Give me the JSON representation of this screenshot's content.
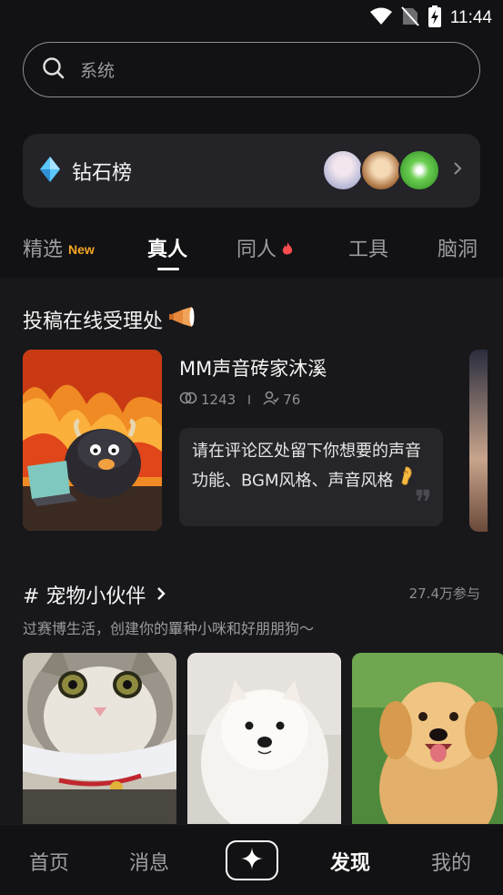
{
  "status_bar": {
    "time": "11:44",
    "icons": [
      "wifi-icon",
      "no-sim-icon",
      "battery-charging-icon"
    ]
  },
  "search": {
    "placeholder": "系统",
    "icon": "search-icon"
  },
  "diamond": {
    "title": "钻石榜",
    "icon": "diamond-icon"
  },
  "tabs": [
    {
      "label": "精选",
      "badge": "New"
    },
    {
      "label": "真人",
      "active": true
    },
    {
      "label": "同人",
      "badge_icon": "fire-icon"
    },
    {
      "label": "工具"
    },
    {
      "label": "脑洞"
    }
  ],
  "section1": {
    "title": "投稿在线受理处",
    "title_icon": "megaphone-icon",
    "card": {
      "name": "MM声音砖家沐溪",
      "views": "1243",
      "followers": "76",
      "quote": "请在评论区处留下你想要的声音功能、BGM风格、声音风格",
      "quote_emoji": "ear-icon"
    }
  },
  "section2": {
    "title": "# 宠物小伙伴",
    "participants": "27.4万参与",
    "description": "过赛博生活，创建你的罼种小咪和好朋朋狗～"
  },
  "bottom_nav": {
    "items": [
      {
        "label": "首页"
      },
      {
        "label": "消息"
      },
      {
        "label": "发现",
        "active": true
      },
      {
        "label": "我的"
      }
    ],
    "create_icon": "sparkle-icon"
  },
  "colors": {
    "background": "#121214",
    "card": "#232328",
    "accent_orange": "#f5a623",
    "fire": "#ff4d4f",
    "diamond": "#5ac8fa"
  }
}
